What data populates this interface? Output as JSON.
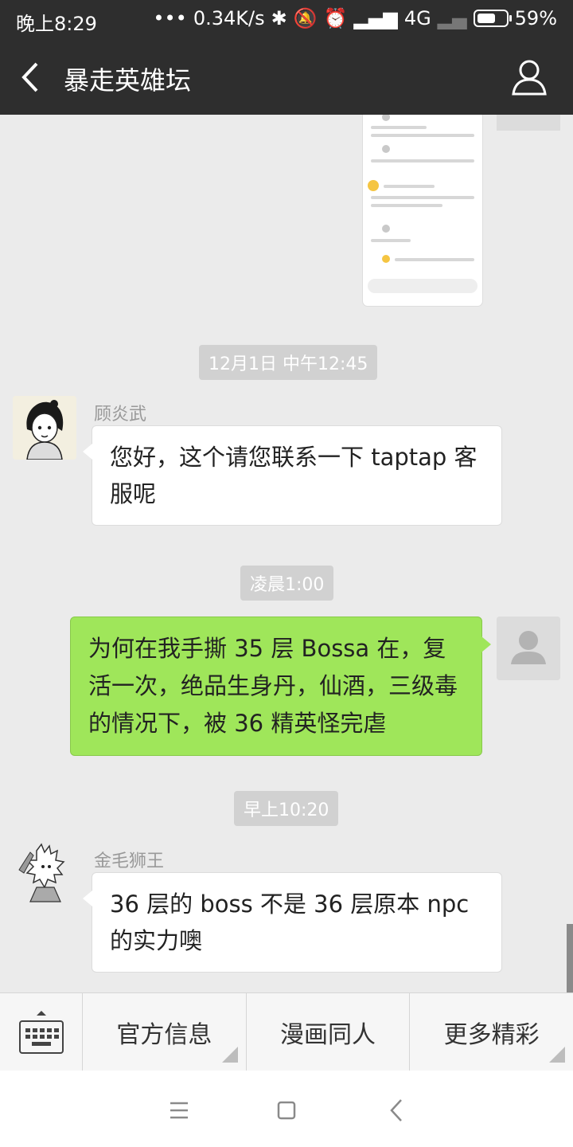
{
  "status_bar": {
    "time": "晚上8:29",
    "network_speed": "0.34K/s",
    "network_type": "4G",
    "battery_percent": 59,
    "battery_text": "59%"
  },
  "header": {
    "title": "暴走英雄坛",
    "back_icon": "chevron-left-icon",
    "profile_icon": "person-icon"
  },
  "messages": [
    {
      "type": "time",
      "text": "12月1日 中午12:45"
    },
    {
      "type": "incoming",
      "sender": "顾炎武",
      "text": "您好，这个请您联系一下 taptap 客服呢"
    },
    {
      "type": "time",
      "text": "凌晨1:00"
    },
    {
      "type": "outgoing",
      "text": "为何在我手撕 35 层 Bossa 在，复活一次，绝品生身丹，仙酒，三级毒的情况下，被 36 精英怪完虐"
    },
    {
      "type": "time",
      "text": "早上10:20"
    },
    {
      "type": "incoming",
      "sender": "金毛狮王",
      "text": "36 层的 boss 不是 36 层原本 npc 的实力噢"
    }
  ],
  "menu": {
    "keyboard_icon": "keyboard-icon",
    "items": [
      "官方信息",
      "漫画同人",
      "更多精彩"
    ]
  },
  "colors": {
    "header_bg": "#2e2e2e",
    "chat_bg": "#ebebeb",
    "outgoing_bubble": "#9fe65a"
  }
}
